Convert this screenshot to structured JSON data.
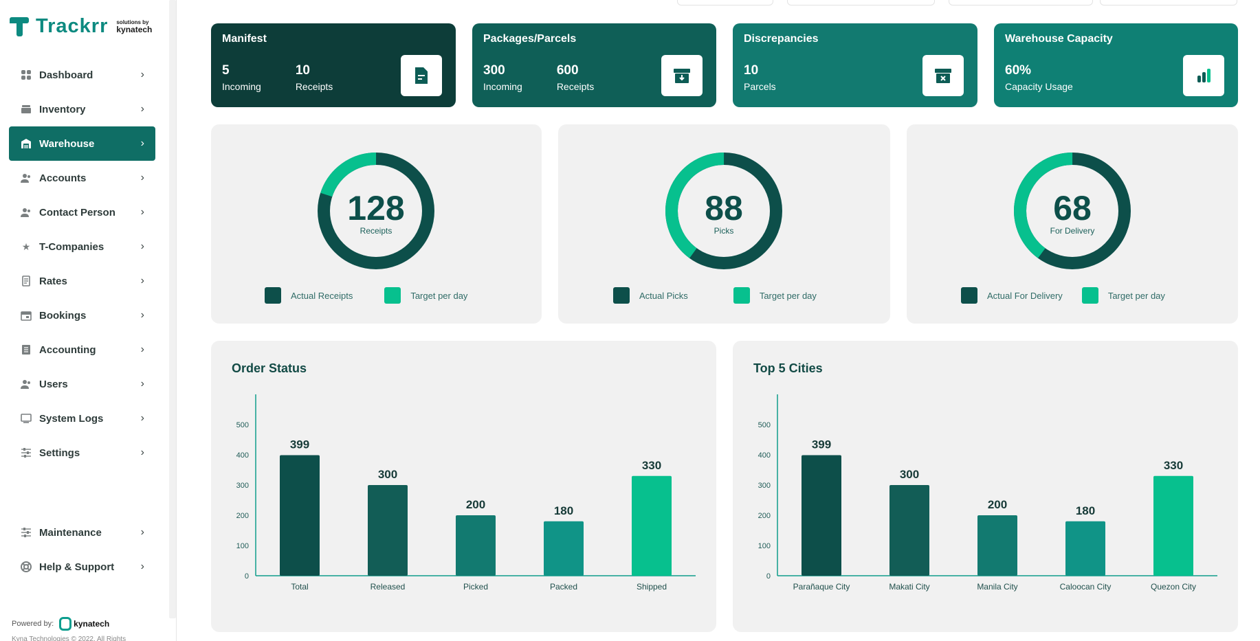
{
  "brand": {
    "name": "Trackrr",
    "sub_line1": "solutions by",
    "sub_line2": "kynatech"
  },
  "sidebar": {
    "items": [
      {
        "label": "Dashboard",
        "icon": "dashboard-icon"
      },
      {
        "label": "Inventory",
        "icon": "inventory-icon"
      },
      {
        "label": "Warehouse",
        "icon": "warehouse-icon",
        "active": true
      },
      {
        "label": "Accounts",
        "icon": "accounts-icon"
      },
      {
        "label": "Contact Person",
        "icon": "contact-person-icon"
      },
      {
        "label": "T-Companies",
        "icon": "star-icon"
      },
      {
        "label": "Rates",
        "icon": "rates-icon"
      },
      {
        "label": "Bookings",
        "icon": "calendar-icon"
      },
      {
        "label": "Accounting",
        "icon": "ledger-icon"
      },
      {
        "label": "Users",
        "icon": "users-icon"
      },
      {
        "label": "System Logs",
        "icon": "monitor-icon"
      },
      {
        "label": "Settings",
        "icon": "sliders-icon"
      }
    ],
    "bottom_items": [
      {
        "label": "Maintenance",
        "icon": "sliders-icon"
      },
      {
        "label": "Help & Support",
        "icon": "lifebuoy-icon"
      }
    ],
    "powered_by": "Powered by:",
    "powered_brand": "kynatech",
    "copyright": "Kyna Technologies © 2022. All Rights"
  },
  "stats": {
    "manifest": {
      "title": "Manifest",
      "v1": "5",
      "l1": "Incoming",
      "v2": "10",
      "l2": "Receipts"
    },
    "packages": {
      "title": "Packages/Parcels",
      "v1": "300",
      "l1": "Incoming",
      "v2": "600",
      "l2": "Receipts"
    },
    "discrepancies": {
      "title": "Discrepancies",
      "v1": "10",
      "l1": "Parcels"
    },
    "capacity": {
      "title": "Warehouse Capacity",
      "v1": "60%",
      "l1": "Capacity Usage"
    }
  },
  "donuts": [
    {
      "value": "128",
      "label": "Receipts",
      "actual_label": "Actual Receipts",
      "target_label": "Target per day",
      "target_fraction": 0.2
    },
    {
      "value": "88",
      "label": "Picks",
      "actual_label": "Actual Picks",
      "target_label": "Target per day",
      "target_fraction": 0.4
    },
    {
      "value": "68",
      "label": "For Delivery",
      "actual_label": "Actual For Delivery",
      "target_label": "Target per day",
      "target_fraction": 0.4
    }
  ],
  "colors": {
    "dark": "#0d4f4a",
    "mid": "#0f6e65",
    "accent": "#07c08e",
    "panel": "#f1f1f1"
  },
  "chart_data": [
    {
      "type": "bar",
      "title": "Order Status",
      "categories": [
        "Total",
        "Released",
        "Picked",
        "Packed",
        "Shipped"
      ],
      "values": [
        399,
        300,
        200,
        180,
        330
      ],
      "ylim": [
        0,
        600
      ],
      "yticks": [
        0,
        100,
        200,
        300,
        400,
        500
      ],
      "bar_colors": [
        "#0d4f4a",
        "#125d56",
        "#127a70",
        "#109487",
        "#07c08e"
      ],
      "grid": false
    },
    {
      "type": "bar",
      "title": "Top 5 Cities",
      "categories": [
        "Parañaque City",
        "Makati City",
        "Manila City",
        "Caloocan City",
        "Quezon City"
      ],
      "values": [
        399,
        300,
        200,
        180,
        330
      ],
      "ylim": [
        0,
        600
      ],
      "yticks": [
        0,
        100,
        200,
        300,
        400,
        500
      ],
      "bar_colors": [
        "#0d4f4a",
        "#125d56",
        "#127a70",
        "#109487",
        "#07c08e"
      ],
      "grid": false
    }
  ]
}
